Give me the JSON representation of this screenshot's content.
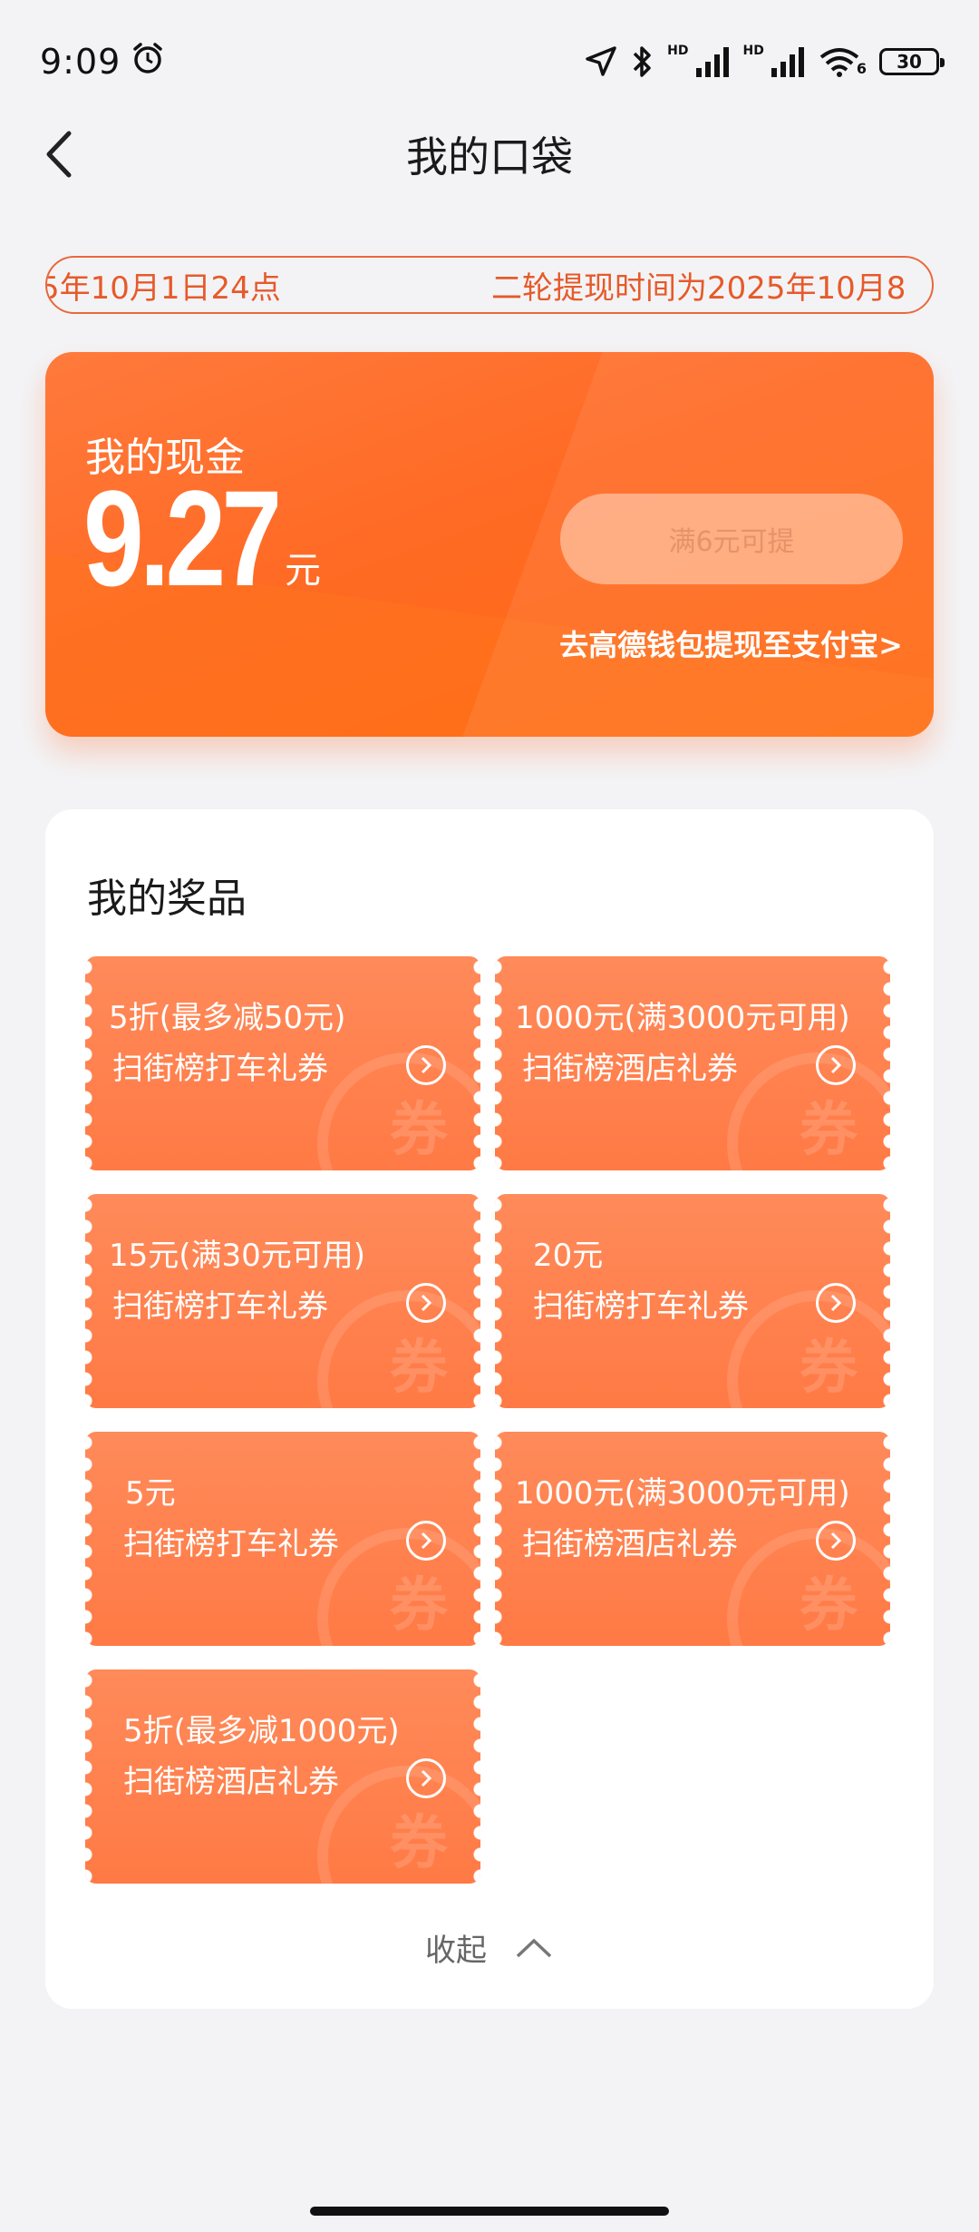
{
  "status_bar": {
    "time": "9:09",
    "icons": [
      "alarm-icon",
      "location-icon",
      "bluetooth-icon",
      "signal-icon",
      "signal-icon",
      "wifi-icon"
    ],
    "network_badge_1": "HD",
    "network_badge_2": "HD",
    "wifi_badge": "6",
    "battery": "30"
  },
  "header": {
    "title": "我的口袋",
    "back_icon": "chevron-left-icon"
  },
  "notice": {
    "text_left": "5年10月1日24点",
    "text_right": "二轮提现时间为2025年10月8"
  },
  "cash": {
    "label": "我的现金",
    "amount": "9.27",
    "unit": "元",
    "withdraw_button": "满6元可提",
    "alipay_link": "去高德钱包提现至支付宝>"
  },
  "prizes": {
    "title": "我的奖品",
    "stamp": "券",
    "coupons": [
      {
        "title": "5折(最多减50元)",
        "subtitle": "扫街榜打车礼券"
      },
      {
        "title": "1000元(满3000元可用)",
        "subtitle": "扫街榜酒店礼券"
      },
      {
        "title": "15元(满30元可用)",
        "subtitle": "扫街榜打车礼券"
      },
      {
        "title": "20元",
        "subtitle": "扫街榜打车礼券"
      },
      {
        "title": "5元",
        "subtitle": "扫街榜打车礼券"
      },
      {
        "title": "1000元(满3000元可用)",
        "subtitle": "扫街榜酒店礼券"
      },
      {
        "title": "5折(最多减1000元)",
        "subtitle": "扫街榜酒店礼券"
      }
    ],
    "collapse_label": "收起"
  },
  "colors": {
    "accent": "#ff6a24",
    "coupon": "#ff7a45",
    "notice_text": "#e65a2a"
  }
}
